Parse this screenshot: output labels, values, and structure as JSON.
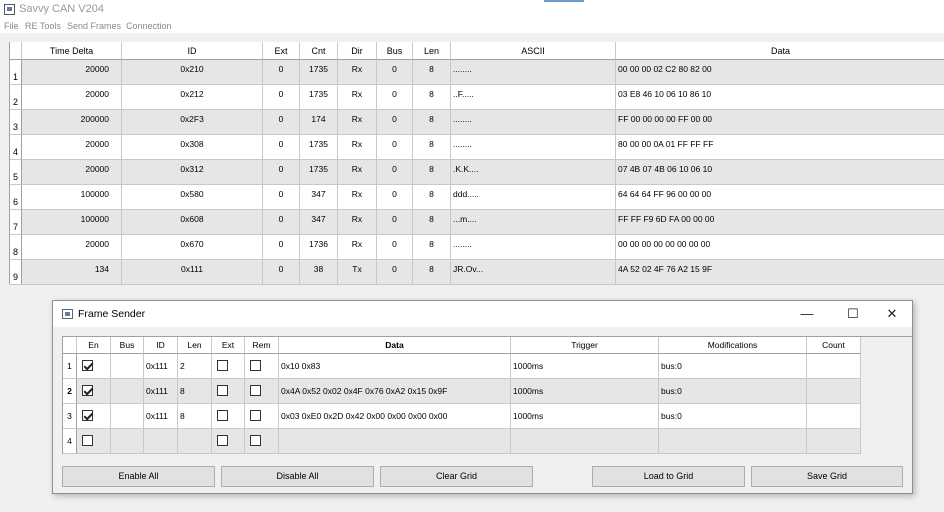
{
  "window": {
    "title": "Savvy CAN V204"
  },
  "menu": [
    "File",
    "RE Tools",
    "Send Frames",
    "Connection"
  ],
  "frames_grid": {
    "columns": [
      "Time Delta",
      "ID",
      "Ext",
      "Cnt",
      "Dir",
      "Bus",
      "Len",
      "ASCII",
      "Data"
    ],
    "rows": [
      {
        "num": "1",
        "time": "20000",
        "id": "0x210",
        "ext": "0",
        "cnt": "1735",
        "dir": "Rx",
        "bus": "0",
        "len": "8",
        "ascii": "........",
        "data": "00 00 00 02 C2 80 82 00"
      },
      {
        "num": "2",
        "time": "20000",
        "id": "0x212",
        "ext": "0",
        "cnt": "1735",
        "dir": "Rx",
        "bus": "0",
        "len": "8",
        "ascii": "..F.....",
        "data": "03 E8 46 10 06 10 86 10"
      },
      {
        "num": "3",
        "time": "200000",
        "id": "0x2F3",
        "ext": "0",
        "cnt": "174",
        "dir": "Rx",
        "bus": "0",
        "len": "8",
        "ascii": "........",
        "data": "FF 00 00 00 00 FF 00 00"
      },
      {
        "num": "4",
        "time": "20000",
        "id": "0x308",
        "ext": "0",
        "cnt": "1735",
        "dir": "Rx",
        "bus": "0",
        "len": "8",
        "ascii": "........",
        "data": "80 00 00 0A 01 FF FF FF"
      },
      {
        "num": "5",
        "time": "20000",
        "id": "0x312",
        "ext": "0",
        "cnt": "1735",
        "dir": "Rx",
        "bus": "0",
        "len": "8",
        "ascii": ".K.K....",
        "data": "07 4B 07 4B 06 10 06 10"
      },
      {
        "num": "6",
        "time": "100000",
        "id": "0x580",
        "ext": "0",
        "cnt": "347",
        "dir": "Rx",
        "bus": "0",
        "len": "8",
        "ascii": "ddd.....",
        "data": "64 64 64 FF 96 00 00 00"
      },
      {
        "num": "7",
        "time": "100000",
        "id": "0x608",
        "ext": "0",
        "cnt": "347",
        "dir": "Rx",
        "bus": "0",
        "len": "8",
        "ascii": "...m....",
        "data": "FF FF F9 6D FA 00 00 00"
      },
      {
        "num": "8",
        "time": "20000",
        "id": "0x670",
        "ext": "0",
        "cnt": "1736",
        "dir": "Rx",
        "bus": "0",
        "len": "8",
        "ascii": "........",
        "data": "00 00 00 00 00 00 00 00"
      },
      {
        "num": "9",
        "time": "134",
        "id": "0x111",
        "ext": "0",
        "cnt": "38",
        "dir": "Tx",
        "bus": "0",
        "len": "8",
        "ascii": "JR.Ov...",
        "data": "4A 52 02 4F 76 A2 15 9F"
      }
    ]
  },
  "frame_sender": {
    "title": "Frame Sender",
    "controls": {
      "minimize": "—",
      "maximize": "☐",
      "close": "✕"
    },
    "columns": [
      "En",
      "Bus",
      "ID",
      "Len",
      "Ext",
      "Rem",
      "Data",
      "Trigger",
      "Modifications",
      "Count"
    ],
    "rows": [
      {
        "num": "1",
        "en": true,
        "bus": "",
        "id": "0x111",
        "len": "2",
        "ext": false,
        "rem": false,
        "data": "0x10 0x83",
        "trigger": "1000ms",
        "mods": "bus:0",
        "count": ""
      },
      {
        "num": "2",
        "en": true,
        "bus": "",
        "id": "0x111",
        "len": "8",
        "ext": false,
        "rem": false,
        "data": "0x4A 0x52 0x02 0x4F 0x76 0xA2 0x15 0x9F",
        "trigger": "1000ms",
        "mods": "bus:0",
        "count": ""
      },
      {
        "num": "3",
        "en": true,
        "bus": "",
        "id": "0x111",
        "len": "8",
        "ext": false,
        "rem": false,
        "data": "0x03 0xE0 0x2D 0x42 0x00 0x00 0x00 0x00",
        "trigger": "1000ms",
        "mods": "bus:0",
        "count": ""
      },
      {
        "num": "4",
        "en": false,
        "bus": "",
        "id": "",
        "len": "",
        "ext": false,
        "rem": false,
        "data": "",
        "trigger": "",
        "mods": "",
        "count": ""
      }
    ],
    "buttons": {
      "enable_all": "Enable All",
      "disable_all": "Disable All",
      "clear_grid": "Clear Grid",
      "load_to_grid": "Load to Grid",
      "save_grid": "Save Grid"
    }
  }
}
